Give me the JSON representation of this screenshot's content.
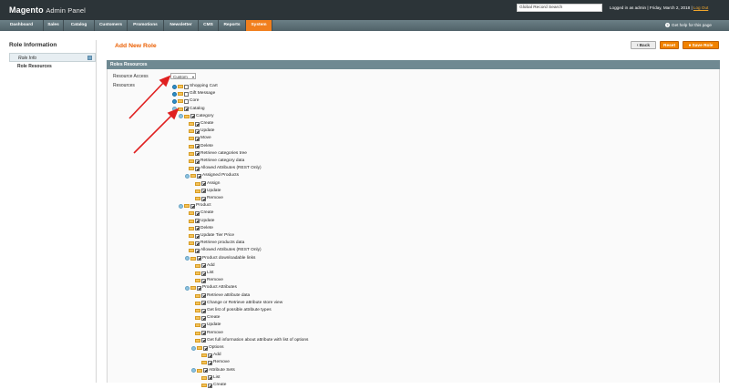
{
  "header": {
    "logo_brand": "Magento",
    "logo_text": "Admin Panel",
    "search_value": "Global Record Search",
    "user_info": "Logged in as admin  |  Friday, March 2, 2018  |",
    "logout_label": "Log Out"
  },
  "nav": {
    "items": [
      {
        "label": "Dashboard"
      },
      {
        "label": "Sales"
      },
      {
        "label": "Catalog"
      },
      {
        "label": "Customers"
      },
      {
        "label": "Promotions"
      },
      {
        "label": "Newsletter"
      },
      {
        "label": "CMS"
      },
      {
        "label": "Reports"
      },
      {
        "label": "System",
        "active": true
      }
    ],
    "help_label": "Get help for this page"
  },
  "sidebar": {
    "title": "Role Information",
    "items": [
      {
        "label": "Role Info"
      },
      {
        "label": "Role Resources"
      }
    ]
  },
  "main": {
    "page_title": "Add New Role",
    "buttons": {
      "back": "Back",
      "reset": "Reset",
      "save": "Save Role"
    },
    "section_title": "Roles Resources",
    "resource_access_label": "Resource Access",
    "resource_access_value": "Custom",
    "resources_label": "Resources"
  },
  "tree": [
    {
      "label": "Shopping Cart",
      "level": 0,
      "expander": "plus",
      "checked": false
    },
    {
      "label": "Gift Message",
      "level": 0,
      "expander": "plus",
      "checked": false
    },
    {
      "label": "Core",
      "level": 0,
      "expander": "plus",
      "checked": false
    },
    {
      "label": "Catalog",
      "level": 0,
      "expander": "minus",
      "checked": true
    },
    {
      "label": "Category",
      "level": 1,
      "expander": "minus",
      "checked": true
    },
    {
      "label": "Create",
      "level": 2,
      "expander": "leaf",
      "checked": true
    },
    {
      "label": "Update",
      "level": 2,
      "expander": "leaf",
      "checked": true
    },
    {
      "label": "Move",
      "level": 2,
      "expander": "leaf",
      "checked": true
    },
    {
      "label": "Delete",
      "level": 2,
      "expander": "leaf",
      "checked": true
    },
    {
      "label": "Retrieve categories tree",
      "level": 2,
      "expander": "leaf",
      "checked": true
    },
    {
      "label": "Retrieve category data",
      "level": 2,
      "expander": "leaf",
      "checked": true
    },
    {
      "label": "Allowed Attributes (REST Only)",
      "level": 2,
      "expander": "leaf",
      "checked": true
    },
    {
      "label": "Assigned Products",
      "level": 2,
      "expander": "minus",
      "checked": true
    },
    {
      "label": "Assign",
      "level": 3,
      "expander": "leaf",
      "checked": true
    },
    {
      "label": "Update",
      "level": 3,
      "expander": "leaf",
      "checked": true
    },
    {
      "label": "Remove",
      "level": 3,
      "expander": "leaf",
      "checked": true
    },
    {
      "label": "Product",
      "level": 1,
      "expander": "minus",
      "checked": true
    },
    {
      "label": "Create",
      "level": 2,
      "expander": "leaf",
      "checked": true
    },
    {
      "label": "Update",
      "level": 2,
      "expander": "leaf",
      "checked": true
    },
    {
      "label": "Delete",
      "level": 2,
      "expander": "leaf",
      "checked": true
    },
    {
      "label": "Update Tier Price",
      "level": 2,
      "expander": "leaf",
      "checked": true
    },
    {
      "label": "Retrieve products data",
      "level": 2,
      "expander": "leaf",
      "checked": true
    },
    {
      "label": "Allowed Attributes (REST Only)",
      "level": 2,
      "expander": "leaf",
      "checked": true
    },
    {
      "label": "Product downloadable links",
      "level": 2,
      "expander": "minus",
      "checked": true
    },
    {
      "label": "Add",
      "level": 3,
      "expander": "leaf",
      "checked": true
    },
    {
      "label": "List",
      "level": 3,
      "expander": "leaf",
      "checked": true
    },
    {
      "label": "Remove",
      "level": 3,
      "expander": "leaf",
      "checked": true
    },
    {
      "label": "Product Attributes",
      "level": 2,
      "expander": "minus",
      "checked": true
    },
    {
      "label": "Retrieve attribute data",
      "level": 3,
      "expander": "leaf",
      "checked": true
    },
    {
      "label": "Change or Retrieve attribute store view",
      "level": 3,
      "expander": "leaf",
      "checked": true
    },
    {
      "label": "Get list of possible attribute types",
      "level": 3,
      "expander": "leaf",
      "checked": true
    },
    {
      "label": "Create",
      "level": 3,
      "expander": "leaf",
      "checked": true
    },
    {
      "label": "Update",
      "level": 3,
      "expander": "leaf",
      "checked": true
    },
    {
      "label": "Remove",
      "level": 3,
      "expander": "leaf",
      "checked": true
    },
    {
      "label": "Get full information about attribute with list of options",
      "level": 3,
      "expander": "leaf",
      "checked": true
    },
    {
      "label": "Options",
      "level": 3,
      "expander": "minus",
      "checked": true
    },
    {
      "label": "Add",
      "level": 4,
      "expander": "leaf",
      "checked": true
    },
    {
      "label": "Remove",
      "level": 4,
      "expander": "leaf",
      "checked": true
    },
    {
      "label": "Attribute Sets",
      "level": 3,
      "expander": "minus",
      "checked": true
    },
    {
      "label": "List",
      "level": 4,
      "expander": "leaf",
      "checked": true
    },
    {
      "label": "Create",
      "level": 4,
      "expander": "leaf",
      "checked": true
    }
  ],
  "colors": {
    "header_bg": "#2c3438",
    "nav_bg": "#506268",
    "nav_active": "#f17f1d",
    "accent_orange": "#eb5e00",
    "section_head": "#6f8992",
    "annotation_arrow": "#e02020"
  },
  "icons": {
    "help": "help-icon",
    "folder": "folder-icon",
    "expand": "expand-icon",
    "collapse": "collapse-icon",
    "checkbox": "checkbox"
  }
}
